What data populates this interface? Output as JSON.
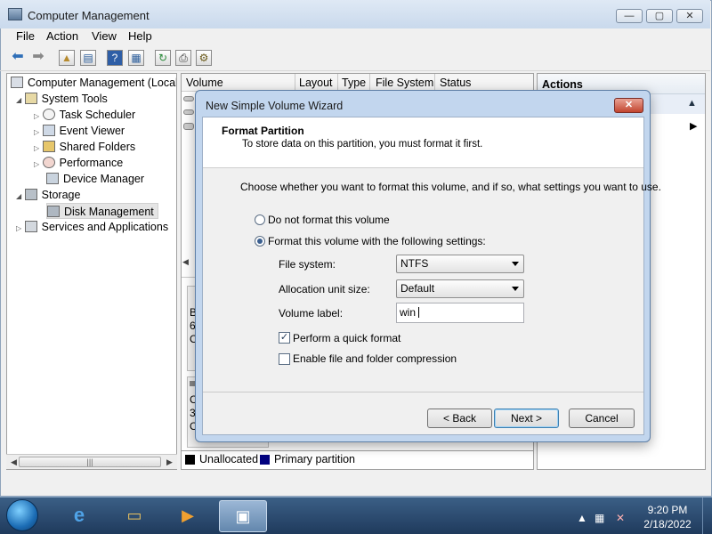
{
  "window": {
    "title": "Computer Management",
    "controls": {
      "minimize": "—",
      "maximize": "▢",
      "close": "✕"
    }
  },
  "menu": [
    "File",
    "Action",
    "View",
    "Help"
  ],
  "toolbar_icons": [
    "back-arrow-icon",
    "forward-arrow-icon",
    "up-folder-icon",
    "show-hide-tree-icon",
    "help-icon",
    "properties-icon",
    "refresh-icon",
    "export-icon",
    "settings-icon"
  ],
  "tree": [
    {
      "label": "Computer Management (Local",
      "level": 0,
      "expander": ""
    },
    {
      "label": "System Tools",
      "level": 1,
      "expander": "◢"
    },
    {
      "label": "Task Scheduler",
      "level": 2,
      "expander": "▷"
    },
    {
      "label": "Event Viewer",
      "level": 2,
      "expander": "▷"
    },
    {
      "label": "Shared Folders",
      "level": 2,
      "expander": "▷"
    },
    {
      "label": "Performance",
      "level": 2,
      "expander": "▷"
    },
    {
      "label": "Device Manager",
      "level": 2,
      "expander": ""
    },
    {
      "label": "Storage",
      "level": 1,
      "expander": "◢"
    },
    {
      "label": "Disk Management",
      "level": 2,
      "expander": ""
    },
    {
      "label": "Services and Applications",
      "level": 1,
      "expander": "▷"
    }
  ],
  "volume_columns": [
    "Volume",
    "Layout",
    "Type",
    "File System",
    "Status"
  ],
  "disk_fragments": {
    "disk0": [
      "B",
      "6(",
      "O"
    ],
    "disk1": [
      "C",
      "3",
      "O"
    ]
  },
  "legend": {
    "unallocated": "Unallocated",
    "primary": "Primary partition",
    "unallocated_color": "#000000",
    "primary_color": "#00007f"
  },
  "actions": {
    "header": "Actions"
  },
  "dialog": {
    "title": "New Simple Volume Wizard",
    "close": "✕",
    "heading": "Format Partition",
    "subheading": "To store data on this partition, you must format it first.",
    "instruction": "Choose whether you want to format this volume, and if so, what settings you want to use.",
    "radio_no_format": "Do not format this volume",
    "radio_format": "Format this volume with the following settings:",
    "file_system_label": "File system:",
    "file_system_value": "NTFS",
    "alloc_label": "Allocation unit size:",
    "alloc_value": "Default",
    "volume_label_label": "Volume label:",
    "volume_label_value": "win",
    "quick_format": "Perform a quick format",
    "compression": "Enable file and folder compression",
    "check_mark": "✓",
    "back": "< Back",
    "next": "Next >",
    "cancel": "Cancel"
  },
  "taskbar": {
    "time": "9:20 PM",
    "date": "2/18/2022"
  }
}
